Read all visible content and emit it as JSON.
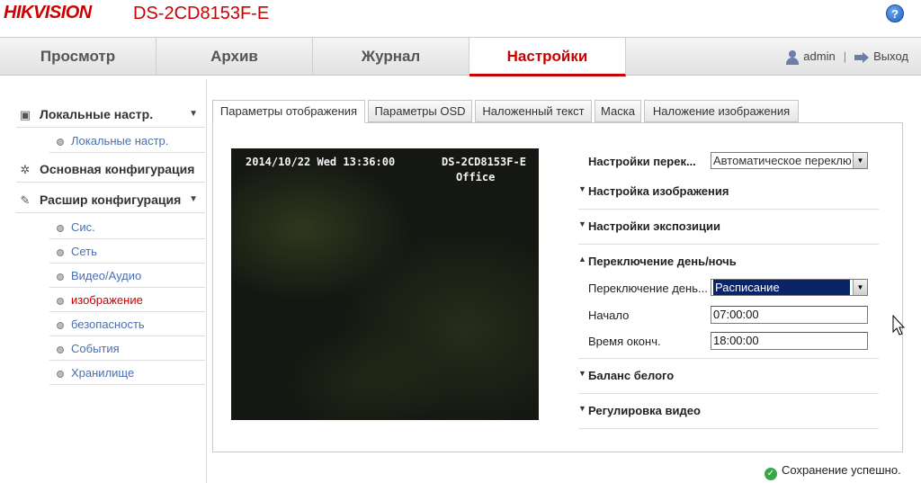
{
  "header": {
    "logo_hik": "HIK",
    "logo_vision": "VISION",
    "model": "DS-2CD8153F-E",
    "help_icon": "question-icon"
  },
  "nav": {
    "tabs": [
      {
        "label": "Просмотр"
      },
      {
        "label": "Архив"
      },
      {
        "label": "Журнал"
      },
      {
        "label": "Настройки",
        "active": true
      }
    ],
    "user": "admin",
    "separator": "|",
    "logout": "Выход"
  },
  "sidebar": {
    "groups": [
      {
        "label": "Локальные настр.",
        "icon": "monitor-icon",
        "items": [
          {
            "label": "Локальные настр."
          }
        ]
      },
      {
        "label": "Основная конфигурация",
        "icon": "gear-icon",
        "items": []
      },
      {
        "label": "Расшир конфигурация",
        "icon": "wrench-icon",
        "items": [
          {
            "label": "Сис."
          },
          {
            "label": "Сеть"
          },
          {
            "label": "Видео/Аудио"
          },
          {
            "label": "изображение",
            "active": true
          },
          {
            "label": "безопасность"
          },
          {
            "label": "События"
          },
          {
            "label": "Хранилище"
          }
        ]
      }
    ]
  },
  "subtabs": [
    {
      "label": "Параметры отображения",
      "active": true
    },
    {
      "label": "Параметры OSD"
    },
    {
      "label": "Наложенный текст"
    },
    {
      "label": "Маска"
    },
    {
      "label": "Наложение изображения"
    }
  ],
  "video": {
    "osd_datetime": "2014/10/22 Wed 13:36:00",
    "osd_camera": "DS-2CD8153F-E",
    "osd_location": "Office"
  },
  "settings": {
    "switch_label": "Настройки перек...",
    "switch_value": "Автоматическое переклю",
    "sections": [
      {
        "title": "Настройка изображения",
        "expanded": false
      },
      {
        "title": "Настройки экспозиции",
        "expanded": false
      },
      {
        "title": "Переключение день/ночь",
        "expanded": true
      },
      {
        "title": "Баланс белого",
        "expanded": false
      },
      {
        "title": "Регулировка видео",
        "expanded": false
      }
    ],
    "daynight": {
      "mode_label": "Переключение день...",
      "mode_value": "Расписание",
      "start_label": "Начало",
      "start_value": "07:00:00",
      "end_label": "Время оконч.",
      "end_value": "18:00:00"
    }
  },
  "status": {
    "message": "Сохранение успешно.",
    "icon": "check-circle-icon"
  },
  "colors": {
    "brand": "#cc0000",
    "link": "#4a6fb0",
    "selection": "#0a246a",
    "success": "#3aa64a"
  }
}
